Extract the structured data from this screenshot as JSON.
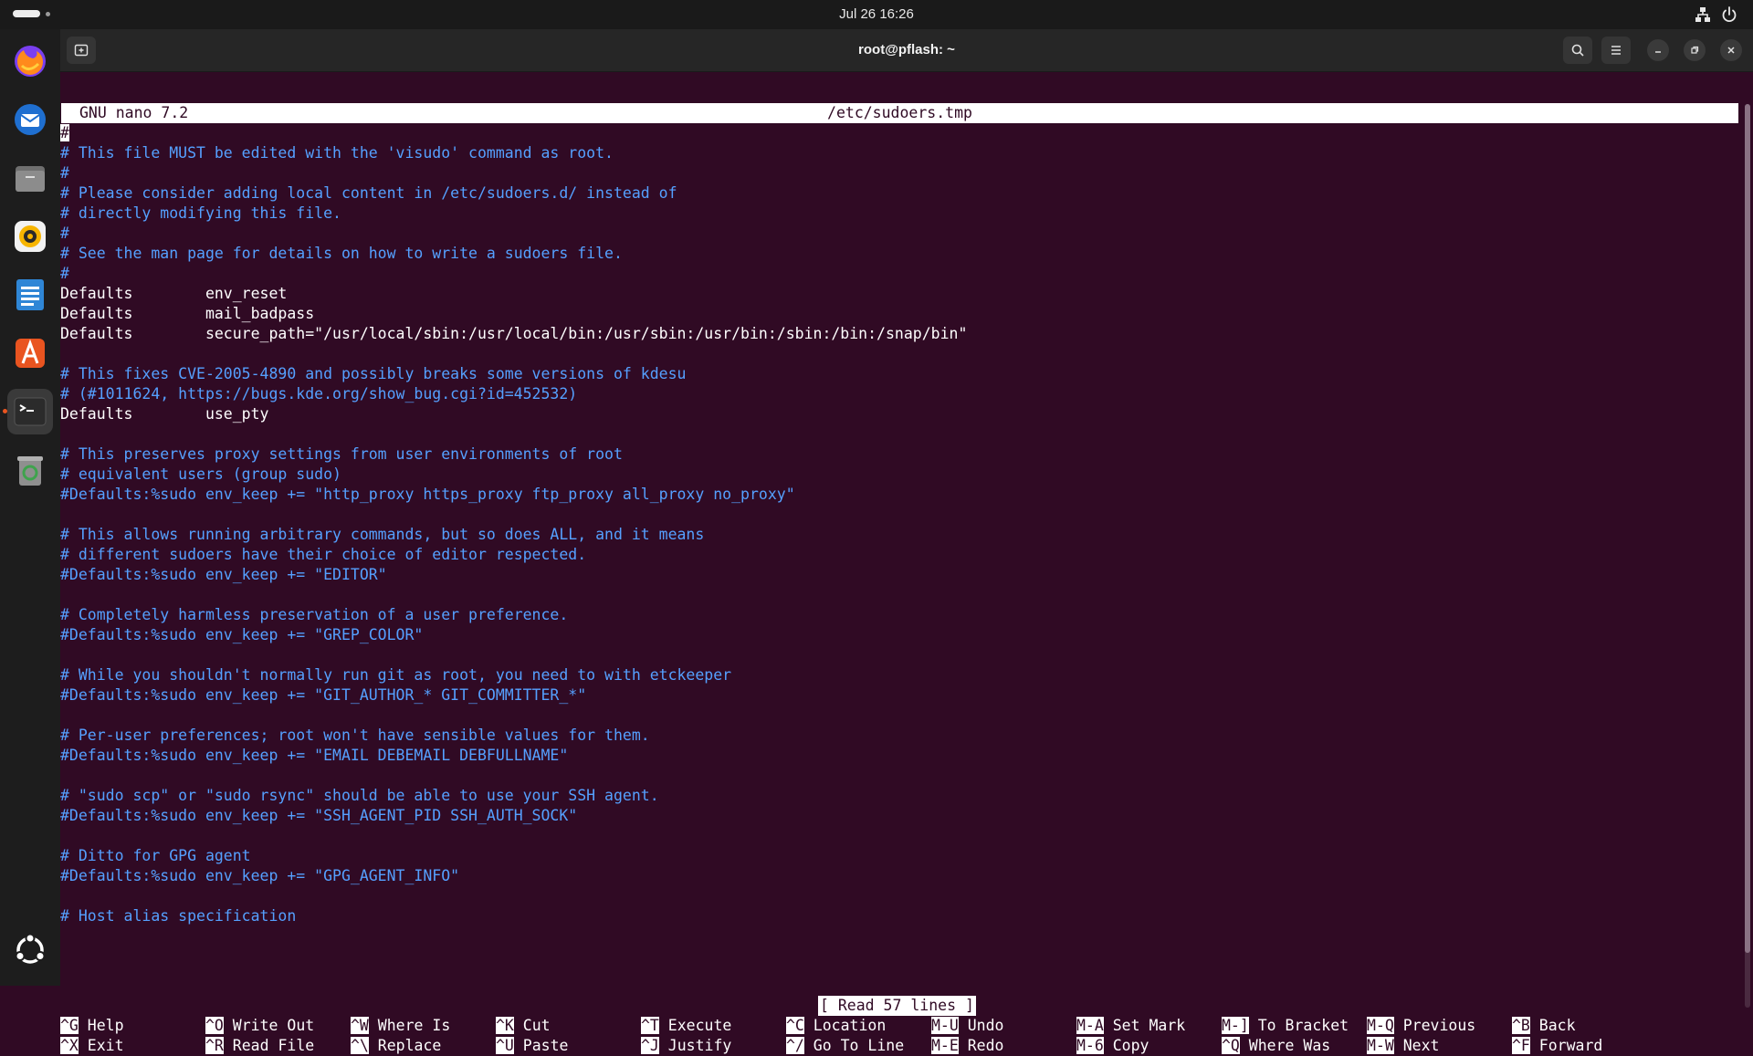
{
  "topbar": {
    "datetime": "Jul 26  16:26"
  },
  "dock": {
    "apps": [
      "firefox-icon",
      "thunderbird-icon",
      "files-icon",
      "rhythmbox-icon",
      "writer-icon",
      "app-center-icon",
      "terminal-icon",
      "trash-icon",
      "show-apps-icon"
    ]
  },
  "window": {
    "title": "root@pflash: ~"
  },
  "nano": {
    "version": "GNU nano 7.2",
    "filename": "/etc/sudoers.tmp",
    "cursor_char": "#",
    "lines": [
      {
        "text": "",
        "type": "comment"
      },
      {
        "text": "# This file MUST be edited with the 'visudo' command as root.",
        "type": "comment"
      },
      {
        "text": "#",
        "type": "comment"
      },
      {
        "text": "# Please consider adding local content in /etc/sudoers.d/ instead of",
        "type": "comment"
      },
      {
        "text": "# directly modifying this file.",
        "type": "comment"
      },
      {
        "text": "#",
        "type": "comment"
      },
      {
        "text": "# See the man page for details on how to write a sudoers file.",
        "type": "comment"
      },
      {
        "text": "#",
        "type": "comment"
      },
      {
        "text": "Defaults        env_reset",
        "type": "plain"
      },
      {
        "text": "Defaults        mail_badpass",
        "type": "plain"
      },
      {
        "text": "Defaults        secure_path=\"/usr/local/sbin:/usr/local/bin:/usr/sbin:/usr/bin:/sbin:/bin:/snap/bin\"",
        "type": "plain"
      },
      {
        "text": "",
        "type": "plain"
      },
      {
        "text": "# This fixes CVE-2005-4890 and possibly breaks some versions of kdesu",
        "type": "comment"
      },
      {
        "text": "# (#1011624, https://bugs.kde.org/show_bug.cgi?id=452532)",
        "type": "comment"
      },
      {
        "text": "Defaults        use_pty",
        "type": "plain"
      },
      {
        "text": "",
        "type": "plain"
      },
      {
        "text": "# This preserves proxy settings from user environments of root",
        "type": "comment"
      },
      {
        "text": "# equivalent users (group sudo)",
        "type": "comment"
      },
      {
        "text": "#Defaults:%sudo env_keep += \"http_proxy https_proxy ftp_proxy all_proxy no_proxy\"",
        "type": "comment"
      },
      {
        "text": "",
        "type": "plain"
      },
      {
        "text": "# This allows running arbitrary commands, but so does ALL, and it means",
        "type": "comment"
      },
      {
        "text": "# different sudoers have their choice of editor respected.",
        "type": "comment"
      },
      {
        "text": "#Defaults:%sudo env_keep += \"EDITOR\"",
        "type": "comment"
      },
      {
        "text": "",
        "type": "plain"
      },
      {
        "text": "# Completely harmless preservation of a user preference.",
        "type": "comment"
      },
      {
        "text": "#Defaults:%sudo env_keep += \"GREP_COLOR\"",
        "type": "comment"
      },
      {
        "text": "",
        "type": "plain"
      },
      {
        "text": "# While you shouldn't normally run git as root, you need to with etckeeper",
        "type": "comment"
      },
      {
        "text": "#Defaults:%sudo env_keep += \"GIT_AUTHOR_* GIT_COMMITTER_*\"",
        "type": "comment"
      },
      {
        "text": "",
        "type": "plain"
      },
      {
        "text": "# Per-user preferences; root won't have sensible values for them.",
        "type": "comment"
      },
      {
        "text": "#Defaults:%sudo env_keep += \"EMAIL DEBEMAIL DEBFULLNAME\"",
        "type": "comment"
      },
      {
        "text": "",
        "type": "plain"
      },
      {
        "text": "# \"sudo scp\" or \"sudo rsync\" should be able to use your SSH agent.",
        "type": "comment"
      },
      {
        "text": "#Defaults:%sudo env_keep += \"SSH_AGENT_PID SSH_AUTH_SOCK\"",
        "type": "comment"
      },
      {
        "text": "",
        "type": "plain"
      },
      {
        "text": "# Ditto for GPG agent",
        "type": "comment"
      },
      {
        "text": "#Defaults:%sudo env_keep += \"GPG_AGENT_INFO\"",
        "type": "comment"
      },
      {
        "text": "",
        "type": "plain"
      },
      {
        "text": "# Host alias specification",
        "type": "comment"
      }
    ],
    "status": "[ Read 57 lines ]",
    "shortcuts": [
      [
        {
          "key": "^G",
          "label": "Help"
        },
        {
          "key": "^X",
          "label": "Exit"
        }
      ],
      [
        {
          "key": "^O",
          "label": "Write Out"
        },
        {
          "key": "^R",
          "label": "Read File"
        }
      ],
      [
        {
          "key": "^W",
          "label": "Where Is"
        },
        {
          "key": "^\\",
          "label": "Replace"
        }
      ],
      [
        {
          "key": "^K",
          "label": "Cut"
        },
        {
          "key": "^U",
          "label": "Paste"
        }
      ],
      [
        {
          "key": "^T",
          "label": "Execute"
        },
        {
          "key": "^J",
          "label": "Justify"
        }
      ],
      [
        {
          "key": "^C",
          "label": "Location"
        },
        {
          "key": "^/",
          "label": "Go To Line"
        }
      ],
      [
        {
          "key": "M-U",
          "label": "Undo"
        },
        {
          "key": "M-E",
          "label": "Redo"
        }
      ],
      [
        {
          "key": "M-A",
          "label": "Set Mark"
        },
        {
          "key": "M-6",
          "label": "Copy"
        }
      ],
      [
        {
          "key": "M-]",
          "label": "To Bracket"
        },
        {
          "key": "^Q",
          "label": "Where Was"
        }
      ],
      [
        {
          "key": "M-Q",
          "label": "Previous"
        },
        {
          "key": "M-W",
          "label": "Next"
        }
      ],
      [
        {
          "key": "^B",
          "label": "Back"
        },
        {
          "key": "^F",
          "label": "Forward"
        }
      ]
    ]
  },
  "colors": {
    "terminal_bg": "#300a24",
    "comment": "#55a0ff",
    "accent": "#e95420"
  }
}
